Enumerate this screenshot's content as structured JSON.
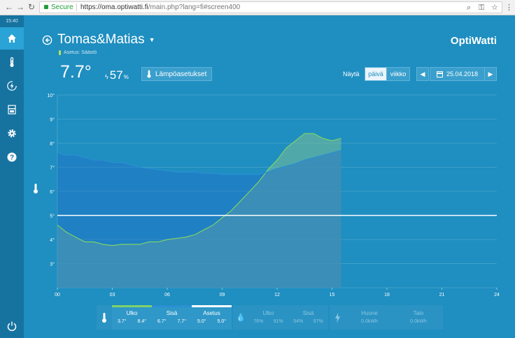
{
  "browser": {
    "secure_label": "Secure",
    "url_host": "https://oma.optiwatti.fi",
    "url_path": "/main.php?lang=fi#screen400"
  },
  "sidebar": {
    "time": "15:40",
    "items": [
      {
        "name": "home-icon",
        "active": true
      },
      {
        "name": "thermometer-icon",
        "active": false
      },
      {
        "name": "energy-icon",
        "active": false
      },
      {
        "name": "device-icon",
        "active": false
      },
      {
        "name": "settings-gear-icon",
        "active": false
      },
      {
        "name": "help-icon",
        "active": false
      }
    ]
  },
  "header": {
    "title": "Tomas&Matias",
    "caret": "▼",
    "logo": "OptiWatti",
    "setting_status": "Asetus: Säästö",
    "temperature": "7.7°",
    "humidity": "57",
    "humidity_unit": "%",
    "temp_settings_button": "Lämpöasetukset"
  },
  "view_controls": {
    "show_label": "Näytä",
    "day_label": "päivä",
    "week_label": "viikko",
    "date": "25.04.2018",
    "prev": "◀",
    "next": "▶"
  },
  "chart_data": {
    "type": "line",
    "x_ticks": [
      "00",
      "03",
      "06",
      "09",
      "12",
      "15",
      "18",
      "21",
      "24"
    ],
    "y_ticks": [
      "3°",
      "4°",
      "5°",
      "6°",
      "7°",
      "8°",
      "9°",
      "10°"
    ],
    "xlim": [
      0,
      24
    ],
    "ylim": [
      2,
      10
    ],
    "setpoint": 5.0,
    "series": [
      {
        "name": "Ulko",
        "color": "#7fd26a",
        "x": [
          0,
          0.5,
          1,
          1.5,
          2,
          2.5,
          3,
          3.5,
          4,
          4.5,
          5,
          5.5,
          6,
          6.5,
          7,
          7.5,
          8,
          8.5,
          9,
          9.5,
          10,
          10.5,
          11,
          11.5,
          12,
          12.5,
          13,
          13.5,
          14,
          14.5,
          15,
          15.5
        ],
        "values": [
          4.6,
          4.3,
          4.1,
          3.9,
          3.9,
          3.8,
          3.75,
          3.8,
          3.8,
          3.8,
          3.9,
          3.9,
          4.0,
          4.05,
          4.1,
          4.2,
          4.4,
          4.6,
          4.9,
          5.2,
          5.6,
          6.0,
          6.4,
          6.9,
          7.3,
          7.8,
          8.1,
          8.4,
          8.4,
          8.2,
          8.1,
          8.2
        ]
      },
      {
        "name": "Sisä",
        "color": "#2a8fd4",
        "x": [
          0,
          0.5,
          1,
          1.5,
          2,
          2.5,
          3,
          3.5,
          4,
          4.5,
          5,
          5.5,
          6,
          6.5,
          7,
          7.5,
          8,
          8.5,
          9,
          9.5,
          10,
          10.5,
          11,
          11.5,
          12,
          12.5,
          13,
          13.5,
          14,
          14.5,
          15,
          15.5
        ],
        "values": [
          7.6,
          7.5,
          7.5,
          7.4,
          7.3,
          7.3,
          7.2,
          7.2,
          7.1,
          7.0,
          6.95,
          6.9,
          6.85,
          6.8,
          6.8,
          6.8,
          6.75,
          6.75,
          6.7,
          6.7,
          6.7,
          6.7,
          6.7,
          6.8,
          6.95,
          7.05,
          7.15,
          7.3,
          7.4,
          7.5,
          7.6,
          7.7
        ]
      }
    ]
  },
  "legend": {
    "temp_group": [
      {
        "label": "Ulko",
        "values": [
          "3.7°",
          "8.4°"
        ],
        "color": "#7fd26a"
      },
      {
        "label": "Sisä",
        "values": [
          "6.7°",
          "7.7°"
        ],
        "color": "#2a8fd4"
      },
      {
        "label": "Asetus",
        "values": [
          "5.0°",
          "5.0°"
        ],
        "color": "#ffffff"
      }
    ],
    "humidity_group": [
      {
        "label": "Ulko",
        "values": [
          "76%",
          "91%"
        ]
      },
      {
        "label": "Sisä",
        "values": [
          "54%",
          "57%"
        ]
      }
    ],
    "energy_group": [
      {
        "label": "Huone",
        "values": [
          "0.0kWh"
        ]
      },
      {
        "label": "Talo",
        "values": [
          "0.0kWh"
        ]
      }
    ]
  }
}
